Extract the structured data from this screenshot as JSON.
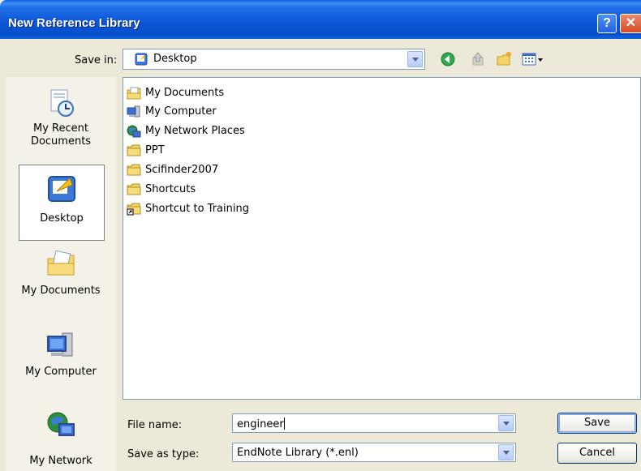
{
  "window": {
    "title": "New Reference Library",
    "help_glyph": "?",
    "close_glyph": "✕"
  },
  "save_in": {
    "label": "Save in:",
    "value": "Desktop",
    "icon": "desktop-icon"
  },
  "toolbar": {
    "icons": [
      "back-arrow-icon",
      "up-folder-icon",
      "new-folder-icon",
      "view-menu-icon"
    ]
  },
  "places": [
    {
      "label": "My Recent\nDocuments",
      "icon": "recent-documents-icon",
      "active": false
    },
    {
      "label": "Desktop",
      "icon": "desktop-icon",
      "active": true
    },
    {
      "label": "My Documents",
      "icon": "my-documents-icon",
      "active": false
    },
    {
      "label": "My Computer",
      "icon": "my-computer-icon",
      "active": false
    },
    {
      "label": "My Network",
      "icon": "my-network-icon",
      "active": false
    }
  ],
  "files": [
    {
      "name": "My Documents",
      "icon": "my-documents-icon"
    },
    {
      "name": "My Computer",
      "icon": "my-computer-icon"
    },
    {
      "name": "My Network Places",
      "icon": "network-places-icon"
    },
    {
      "name": "PPT",
      "icon": "folder-icon"
    },
    {
      "name": "Scifinder2007",
      "icon": "folder-icon"
    },
    {
      "name": "Shortcuts",
      "icon": "folder-icon"
    },
    {
      "name": "Shortcut to Training",
      "icon": "shortcut-folder-icon"
    }
  ],
  "filename": {
    "label": "File name:",
    "value": "engineer"
  },
  "savetype": {
    "label": "Save as type:",
    "value": "EndNote Library (*.enl)"
  },
  "buttons": {
    "save": "Save",
    "cancel": "Cancel"
  },
  "colors": {
    "titlebar": "#0b55d6",
    "dialog_bg": "#ece9d8",
    "border": "#7f9db9"
  }
}
